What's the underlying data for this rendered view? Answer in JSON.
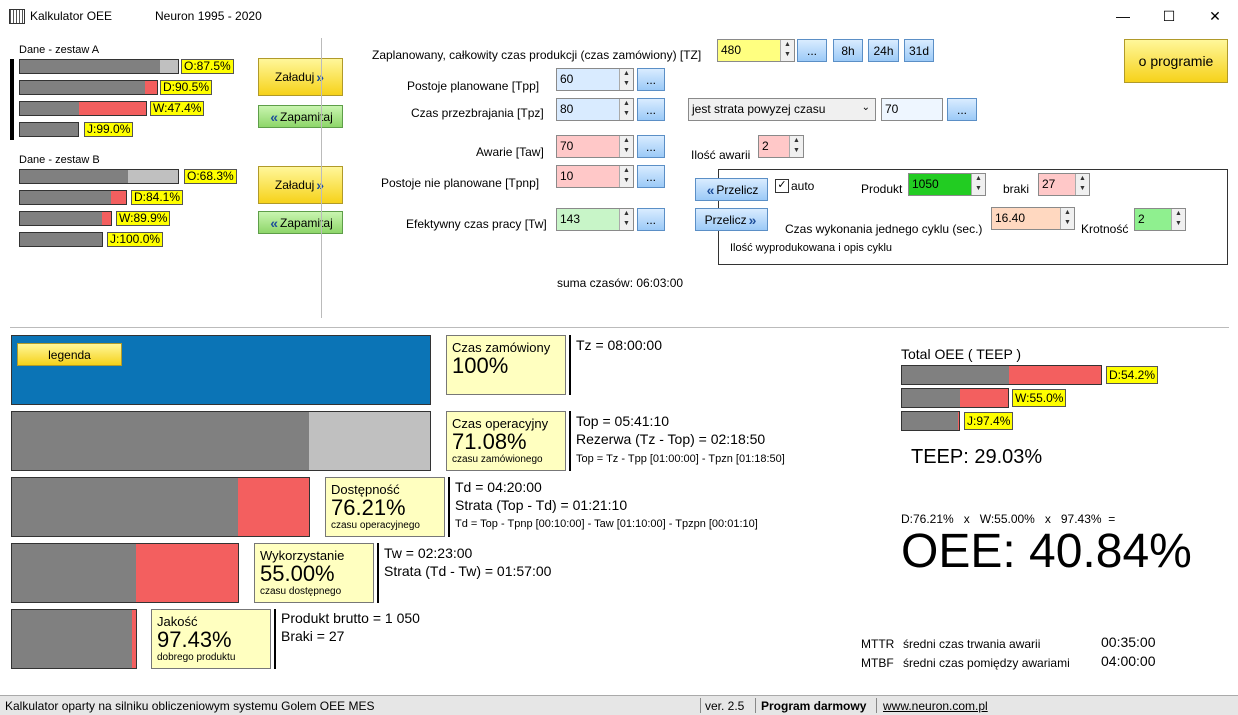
{
  "window": {
    "title": "Kalkulator OEE",
    "subtitle": "Neuron 1995 - 2020",
    "min": "—",
    "max": "☐",
    "close": "✕"
  },
  "setA": {
    "title": "Dane - zestaw A",
    "O": "O:87.5%",
    "D": "D:90.5%",
    "W": "W:47.4%",
    "J": "J:99.0%",
    "load": "Załaduj",
    "save": "Zapamitaj"
  },
  "setB": {
    "title": "Dane - zestaw B",
    "O": "O:68.3%",
    "D": "D:84.1%",
    "W": "W:89.9%",
    "J": "J:100.0%",
    "load": "Załaduj",
    "save": "Zapamitaj"
  },
  "form": {
    "tz_label": "Zaplanowany, całkowity czas produkcji (czas zamówiony)  [TZ]",
    "tz": "480",
    "btn_dots": "...",
    "btn_8h": "8h",
    "btn_24h": "24h",
    "btn_31d": "31d",
    "tpp_label": "Postoje planowane [Tpp]",
    "tpp": "60",
    "tpz_label": "Czas przezbrajania [Tpz]",
    "tpz": "80",
    "dropdown": "jest strata powyzej czasu",
    "dropdown_val": "70",
    "taw_label": "Awarie [Taw]",
    "taw": "70",
    "awarii_label": "Ilość awarii",
    "awarii": "2",
    "tpnp_label": "Postoje nie planowane [Tpnp]",
    "tpnp": "10",
    "tw_label": "Efektywny czas pracy [Tw]",
    "tw": "143",
    "sum": "suma czasów: 06:03:00"
  },
  "prod": {
    "przelicz": "Przelicz",
    "auto": "auto",
    "produkt_label": "Produkt",
    "produkt": "1050",
    "braki_label": "braki",
    "braki": "27",
    "cycle_label": "Czas wykonania jednego cyklu (sec.)",
    "cycle": "16.40",
    "krot_label": "Krotność",
    "krot": "2",
    "desc": "Ilość wyprodukowana i opis cyklu"
  },
  "about": "o programie",
  "legend": "legenda",
  "rows": [
    {
      "a": "Czas zamówiony",
      "b": "100%",
      "c": "",
      "t1": "Tz = 08:00:00",
      "t2": "",
      "t3": ""
    },
    {
      "a": "Czas operacyjny",
      "b": "71.08%",
      "c": "czasu zamówionego",
      "t1": "Top = 05:41:10",
      "t2": "Rezerwa (Tz - Top) = 02:18:50",
      "t3": "Top = Tz - Tpp [01:00:00]  - Tpzn [01:18:50]"
    },
    {
      "a": "Dostępność",
      "b": "76.21%",
      "c": "czasu operacyjnego",
      "t1": "Td = 04:20:00",
      "t2": "Strata (Top - Td) = 01:21:10",
      "t3": "Td = Top - Tpnp [00:10:00]  - Taw [01:10:00]  - Tpzpn [00:01:10]"
    },
    {
      "a": "Wykorzystanie",
      "b": "55.00%",
      "c": "czasu dostępnego",
      "t1": "Tw = 02:23:00",
      "t2": "Strata (Td - Tw) = 01:57:00",
      "t3": ""
    },
    {
      "a": "Jakość",
      "b": "97.43%",
      "c": "dobrego produktu",
      "t1": "Produkt brutto = 1 050",
      "t2": "Braki = 27",
      "t3": ""
    }
  ],
  "teep": {
    "title": "Total OEE ( TEEP )",
    "D": "D:54.2%",
    "W": "W:55.0%",
    "J": "J:97.4%",
    "value": "TEEP: 29.03%"
  },
  "oee": {
    "formula": "D:76.21%   x   W:55.00%   x   97.43%  =",
    "value": "OEE: 40.84%"
  },
  "mttr": {
    "l": "MTTR",
    "d": "średni czas trwania awarii",
    "v": "00:35:00"
  },
  "mtbf": {
    "l": "MTBF",
    "d": "średni czas pomiędzy awariami",
    "v": "04:00:00"
  },
  "status": {
    "left": "Kalkulator oparty na silniku obliczeniowym systemu Golem OEE MES",
    "ver": "ver. 2.5",
    "free": "Program darmowy",
    "url": "www.neuron.com.pl"
  }
}
